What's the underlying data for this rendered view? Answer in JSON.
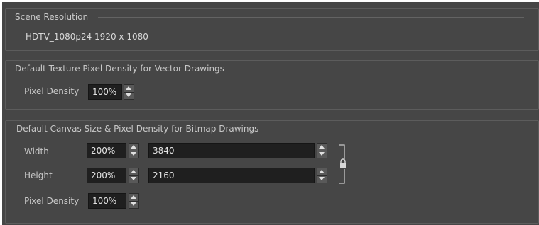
{
  "scene_resolution": {
    "title": "Scene Resolution",
    "value": "HDTV_1080p24  1920 x 1080"
  },
  "vector_density": {
    "title": "Default Texture Pixel Density for Vector Drawings",
    "pixel_density_label": "Pixel Density",
    "pixel_density_value": "100%"
  },
  "bitmap_canvas": {
    "title": "Default Canvas Size & Pixel Density for Bitmap Drawings",
    "width_label": "Width",
    "width_percent": "200%",
    "width_pixels": "3840",
    "height_label": "Height",
    "height_percent": "200%",
    "height_pixels": "2160",
    "pixel_density_label": "Pixel Density",
    "pixel_density_value": "100%",
    "aspect_lock_icon": "lock-icon"
  }
}
